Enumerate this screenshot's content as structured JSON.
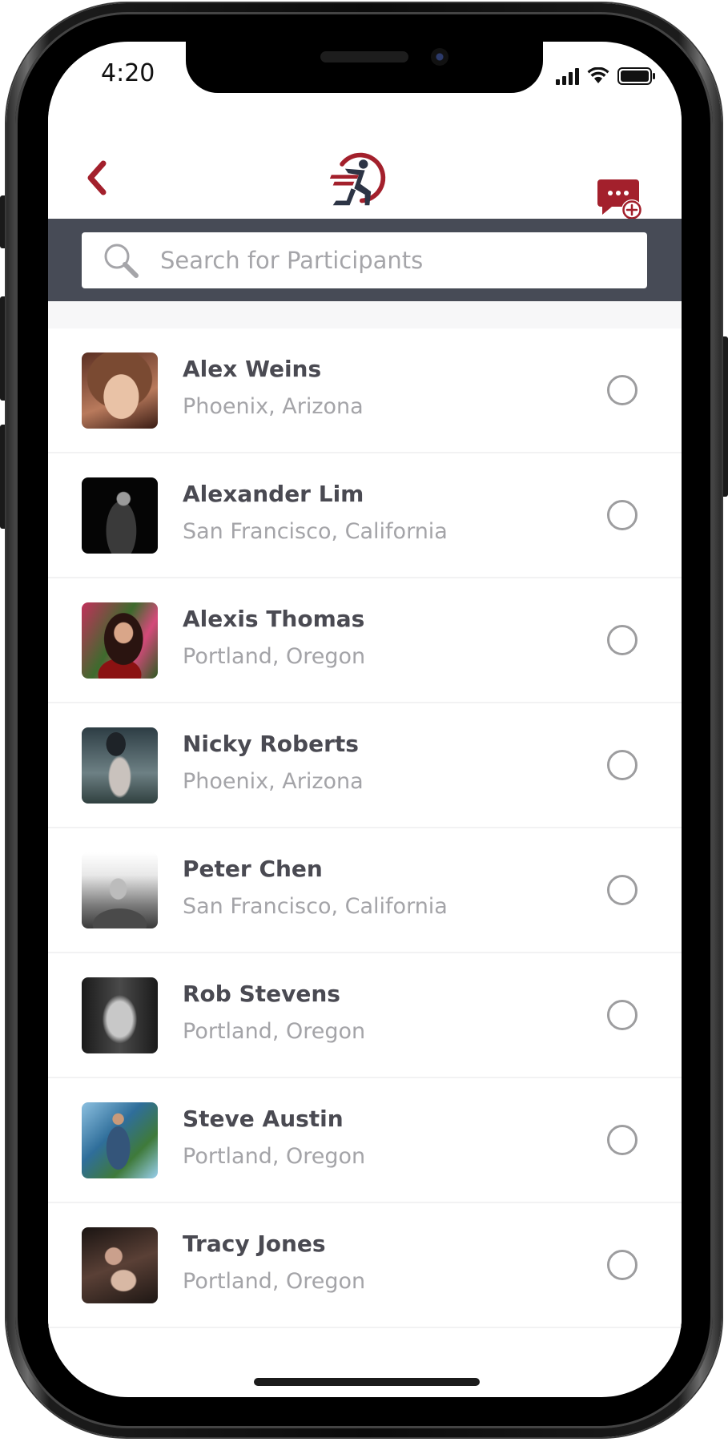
{
  "status_bar": {
    "time": "4:20"
  },
  "header": {
    "back_icon": "chevron-left-icon",
    "logo": "runner-logo",
    "action_icon": "new-message-icon"
  },
  "search": {
    "placeholder": "Search for Participants",
    "value": ""
  },
  "participants": [
    {
      "name": "Alex Weins",
      "location": "Phoenix, Arizona",
      "selected": false
    },
    {
      "name": "Alexander Lim",
      "location": "San Francisco, California",
      "selected": false
    },
    {
      "name": "Alexis Thomas",
      "location": "Portland, Oregon",
      "selected": false
    },
    {
      "name": "Nicky Roberts",
      "location": "Phoenix, Arizona",
      "selected": false
    },
    {
      "name": "Peter Chen",
      "location": "San Francisco, California",
      "selected": false
    },
    {
      "name": "Rob Stevens",
      "location": "Portland, Oregon",
      "selected": false
    },
    {
      "name": "Steve Austin",
      "location": "Portland, Oregon",
      "selected": false
    },
    {
      "name": "Tracy Jones",
      "location": "Portland, Oregon",
      "selected": false
    }
  ],
  "colors": {
    "accent": "#a3202c",
    "logo_dark": "#2c3445",
    "search_bar_bg": "#474b56",
    "name_text": "#4a4a52",
    "location_text": "#a4a4a8"
  }
}
